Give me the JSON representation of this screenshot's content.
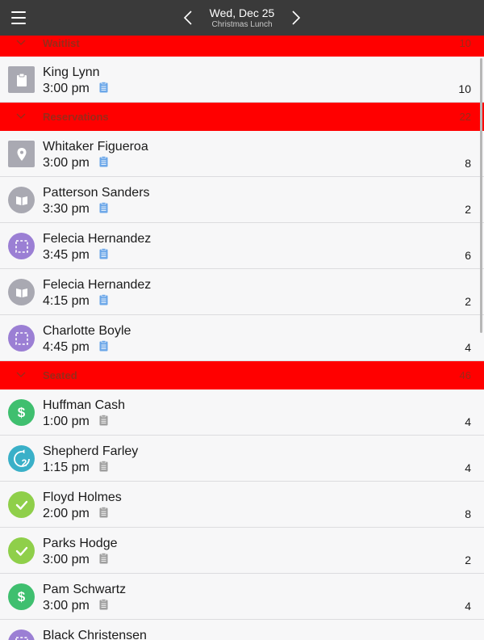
{
  "header": {
    "date": "Wed, Dec 25",
    "shift": "Christmas Lunch",
    "icons": {
      "menu": "hamburger-icon",
      "prev": "chevron-left-icon",
      "next": "chevron-right-icon"
    }
  },
  "colors": {
    "topbar": "#3a3a3a",
    "section_bg": "#ff0000",
    "section_text": "#9a2a18",
    "gray_status": "#a9a9b2",
    "purple_status": "#9b7fd4",
    "green_status": "#8fcf4a",
    "money_green": "#3fbf6f",
    "teal_status": "#3ab0c8",
    "note_blue": "#6aa6e8",
    "note_gray": "#9e9e9e"
  },
  "sections": [
    {
      "title": "Waitlist",
      "count": "10",
      "rows": [
        {
          "name": "King Lynn",
          "time": "3:00 pm",
          "party": "10",
          "status_icon": "clipboard-icon",
          "note_icon": "note-icon"
        }
      ]
    },
    {
      "title": "Reservations",
      "count": "22",
      "rows": [
        {
          "name": "Whitaker Figueroa",
          "time": "3:00 pm",
          "party": "8",
          "status_icon": "pin-icon",
          "note_icon": "note-icon"
        },
        {
          "name": "Patterson Sanders",
          "time": "3:30 pm",
          "party": "2",
          "status_icon": "book-icon",
          "note_icon": "note-icon"
        },
        {
          "name": "Felecia Hernandez",
          "time": "3:45 pm",
          "party": "6",
          "status_icon": "dashed-square-icon",
          "note_icon": "note-icon"
        },
        {
          "name": "Felecia Hernandez",
          "time": "4:15 pm",
          "party": "2",
          "status_icon": "book-icon",
          "note_icon": "note-icon"
        },
        {
          "name": "Charlotte Boyle",
          "time": "4:45 pm",
          "party": "4",
          "status_icon": "dashed-square-icon",
          "note_icon": "note-icon"
        }
      ]
    },
    {
      "title": "Seated",
      "count": "46",
      "rows": [
        {
          "name": "Huffman Cash",
          "time": "1:00 pm",
          "party": "4",
          "status_icon": "dollar-icon",
          "note_icon": "note-icon"
        },
        {
          "name": "Shepherd Farley",
          "time": "1:15 pm",
          "party": "4",
          "status_icon": "refresh-two-icon",
          "badge": "2",
          "note_icon": "note-icon"
        },
        {
          "name": "Floyd Holmes",
          "time": "2:00 pm",
          "party": "8",
          "status_icon": "check-icon",
          "note_icon": "note-icon"
        },
        {
          "name": "Parks Hodge",
          "time": "3:00 pm",
          "party": "2",
          "status_icon": "check-icon",
          "note_icon": "note-icon"
        },
        {
          "name": "Pam Schwartz",
          "time": "3:00 pm",
          "party": "4",
          "status_icon": "dollar-icon",
          "note_icon": "note-icon"
        },
        {
          "name": "Black Christensen",
          "time": "",
          "party": "",
          "status_icon": "dashed-square-icon",
          "note_icon": "note-icon"
        }
      ]
    }
  ]
}
